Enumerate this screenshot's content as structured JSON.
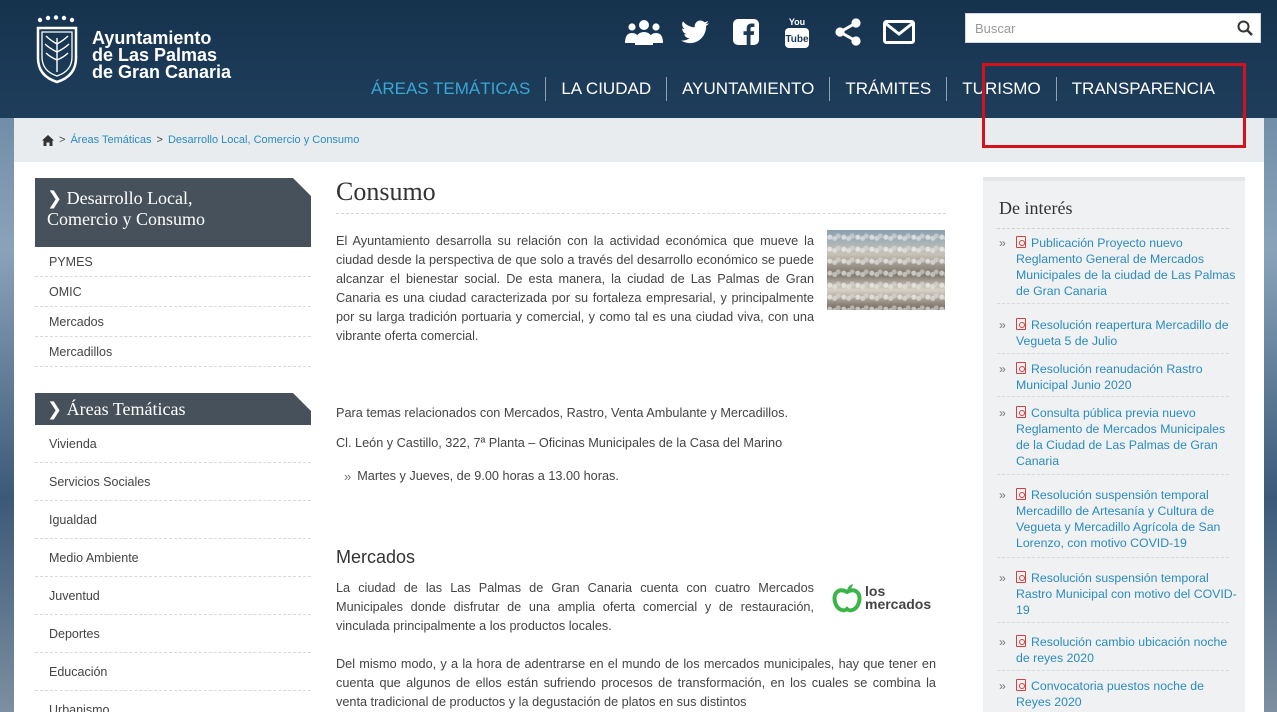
{
  "header": {
    "logo_lines": [
      "Ayuntamiento",
      "de Las Palmas",
      "de Gran Canaria"
    ],
    "social_icons": [
      "community-icon",
      "twitter-icon",
      "facebook-icon",
      "youtube-icon",
      "share-icon",
      "mail-icon"
    ],
    "youtube_text": [
      "You",
      "Tube"
    ],
    "search_placeholder": "Buscar",
    "nav": [
      "ÁREAS TEMÁTICAS",
      "LA CIUDAD",
      "AYUNTAMIENTO",
      "TRÁMITES",
      "TURISMO",
      "TRANSPARENCIA"
    ],
    "nav_active_color": "#3aa7d4"
  },
  "breadcrumb": {
    "sep": ">",
    "items": [
      "Áreas Temáticas",
      "Desarrollo Local, Comercio y Consumo"
    ]
  },
  "sidebar": {
    "section1_title_1": "Desarrollo Local,",
    "section1_title_2": "Comercio y Consumo",
    "section1_items": [
      "PYMES",
      "OMIC",
      "Mercados",
      "Mercadillos"
    ],
    "section2_title": "Áreas Temáticas",
    "section2_items": [
      "Vivienda",
      "Servicios Sociales",
      "Igualdad",
      "Medio Ambiente",
      "Juventud",
      "Deportes",
      "Educación",
      "Urbanismo"
    ]
  },
  "main": {
    "title": "Consumo",
    "intro": "El Ayuntamiento desarrolla su relación con la actividad económica que mueve la ciudad desde la perspectiva de que solo a través del desarrollo económico se puede alcanzar el bienestar social. De esta manera, la ciudad de Las Palmas de Gran Canaria es una ciudad caracterizada por su fortaleza empresarial, y principalmente por su larga tradición portuaria y comercial, y como tal es una ciudad viva, con una vibrante oferta comercial.",
    "topics": "Para temas relacionados con Mercados, Rastro, Venta Ambulante y Mercadillos.",
    "address": "Cl. León y Castillo, 322, 7ª Planta – Oficinas Municipales de la Casa del Marino",
    "schedule": "Martes y Jueves, de 9.00 horas a 13.00 horas.",
    "mercados_title": "Mercados",
    "mercados_text": "La ciudad de las Las Palmas de Gran Canaria cuenta con cuatro Mercados Municipales donde disfrutar de una amplia oferta comercial y de restauración, vinculada principalmente a los productos locales.",
    "mercados_text2": "Del mismo modo, y a la hora de adentrarse en el mundo de los mercados municipales, hay que tener en cuenta que algunos de ellos están sufriendo procesos de transformación, en los cuales se combina la venta tradicional de productos y la degustación de platos en sus distintos",
    "mercados_logo_1": "los",
    "mercados_logo_2": "mercados"
  },
  "right": {
    "title": "De interés",
    "items": [
      "Publicación Proyecto nuevo Reglamento General de Mercados Municipales de la ciudad de Las Palmas de Gran Canaria",
      "Resolución reapertura Mercadillo de Vegueta 5 de Julio",
      "Resolución reanudación Rastro Municipal Junio 2020",
      "Consulta pública previa nuevo Reglamento de Mercados Municipales de la Ciudad de Las Palmas de Gran Canaria",
      "Resolución suspensión temporal Mercadillo de Artesanía y Cultura de Vegueta y Mercadillo Agrícola de San Lorenzo, con motivo COVID-19",
      "Resolución suspensión temporal Rastro Municipal con motivo del COVID-19",
      "Resolución cambio ubicación noche de reyes 2020",
      "Convocatoria puestos noche de Reyes 2020"
    ],
    "highlight_color": "#d3121b",
    "link_color": "#2a8bbf"
  }
}
